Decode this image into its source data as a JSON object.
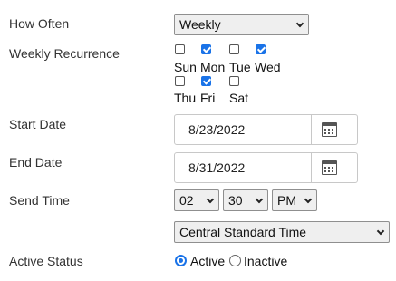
{
  "labels": {
    "how_often": "How Often",
    "weekly_recurrence": "Weekly Recurrence",
    "start_date": "Start Date",
    "end_date": "End Date",
    "send_time": "Send Time",
    "active_status": "Active Status"
  },
  "how_often": {
    "value": "Weekly"
  },
  "weekdays": [
    {
      "label": "Sun",
      "checked": false
    },
    {
      "label": "Mon",
      "checked": true
    },
    {
      "label": "Tue",
      "checked": false
    },
    {
      "label": "Wed",
      "checked": true
    },
    {
      "label": "Thu",
      "checked": false
    },
    {
      "label": "Fri",
      "checked": true
    },
    {
      "label": "Sat",
      "checked": false
    }
  ],
  "start_date": {
    "value": "8/23/2022",
    "icon": "calendar-icon"
  },
  "end_date": {
    "value": "8/31/2022",
    "icon": "calendar-icon"
  },
  "send_time": {
    "hour": "02",
    "minute": "30",
    "ampm": "PM"
  },
  "timezone": {
    "value": "Central Standard Time"
  },
  "active_status": {
    "active_label": "Active",
    "inactive_label": "Inactive",
    "selected": "Active"
  },
  "colors": {
    "accent": "#1a73e8",
    "select_bg": "#efefef"
  }
}
